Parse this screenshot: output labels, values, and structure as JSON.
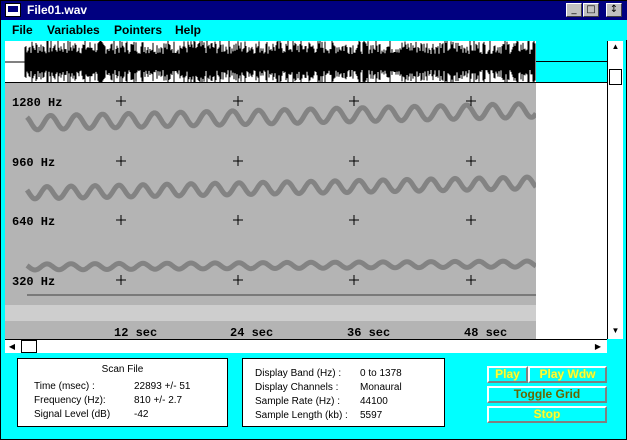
{
  "window": {
    "title": "File01.wav"
  },
  "titlebar_buttons": {
    "minimize": "_",
    "maximize": "□",
    "restore": "↕"
  },
  "menu": {
    "file": "File",
    "variables": "Variables",
    "pointers": "Pointers",
    "help": "Help"
  },
  "spectrogram": {
    "freq_labels": [
      "1280 Hz",
      "960 Hz",
      "640 Hz",
      "320 Hz"
    ],
    "time_labels": [
      "12 sec",
      "24 sec",
      "36 sec",
      "48 sec"
    ]
  },
  "scan_panel": {
    "title": "Scan File",
    "rows": [
      {
        "label": "Time (msec) :",
        "value": "22893 +/- 51"
      },
      {
        "label": "Frequency (Hz):",
        "value": "810  +/- 2.7"
      },
      {
        "label": "Signal Level (dB)",
        "value": "-42"
      }
    ]
  },
  "display_panel": {
    "rows": [
      {
        "label": "Display Band (Hz) :",
        "value": "0 to 1378"
      },
      {
        "label": "Display Channels :",
        "value": "Monaural"
      },
      {
        "label": "Sample Rate (Hz) :",
        "value": "44100"
      },
      {
        "label": "Sample Length (kb) :",
        "value": "5597"
      }
    ]
  },
  "buttons": {
    "play": "Play",
    "play_wdw": "Play Wdw",
    "toggle_grid": "Toggle Grid",
    "stop": "Stop"
  },
  "colors": {
    "background": "#00ffff",
    "titlebar": "#000080",
    "spectrogram_bg": "#b4b4b4",
    "trace": "#7a7a7a",
    "button_text": "#ffff00"
  }
}
